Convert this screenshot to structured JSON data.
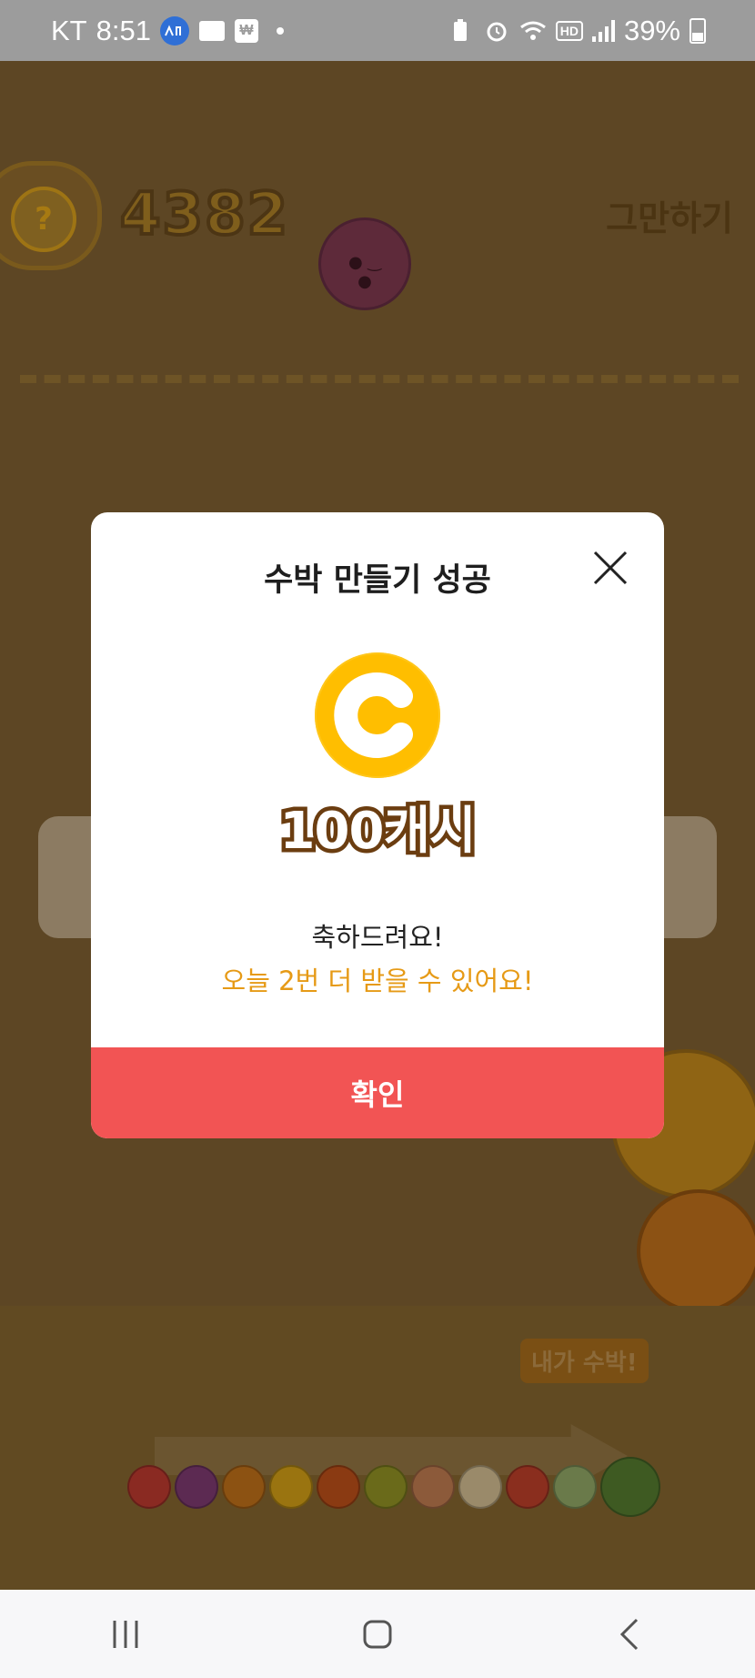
{
  "status_bar": {
    "carrier": "KT",
    "time": "8:51",
    "battery_percent": "39%",
    "icons": [
      "app-badge-icon",
      "folder-icon",
      "wallet-icon",
      "notification-dot-icon",
      "battery-saver-icon",
      "alarm-icon",
      "wifi-icon",
      "hd-voice-icon",
      "signal-icon",
      "battery-icon"
    ],
    "hd_label": "HD"
  },
  "game": {
    "score": "4382",
    "help_label": "?",
    "quit_label": "그만하기",
    "evolution_badge": "내가 수박!",
    "evolution_colors": [
      "#8a2a22",
      "#5c2a52",
      "#8c5212",
      "#9a7410",
      "#8a3a12",
      "#6a6a1a",
      "#8c5a3a",
      "#9a8a6a",
      "#8a2e1e",
      "#6a7a4a"
    ],
    "colors": {
      "overlay_background": "#5d4624"
    }
  },
  "modal": {
    "title": "수박 만들기 성공",
    "reward": "100캐시",
    "message_line1": "축하드려요!",
    "message_line2": "오늘 2번 더 받을 수 있어요!",
    "confirm_label": "확인",
    "colors": {
      "coin": "#ffbe00",
      "confirm_button": "#f25454",
      "highlight_text": "#e69a16"
    }
  },
  "nav_bar": {
    "icons": [
      "recent-apps-icon",
      "home-icon",
      "back-icon"
    ]
  }
}
